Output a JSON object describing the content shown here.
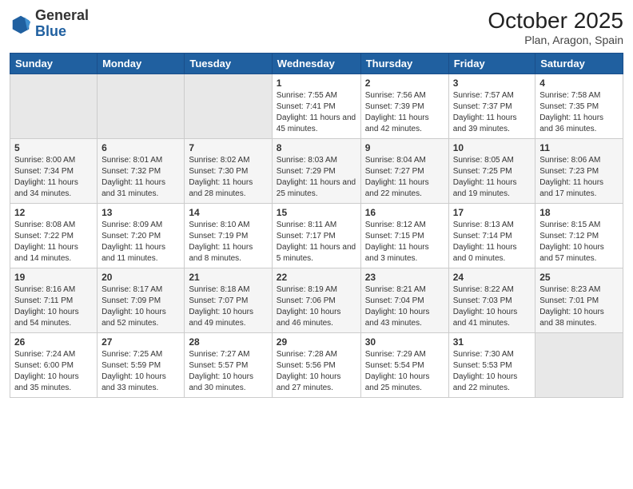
{
  "header": {
    "logo_general": "General",
    "logo_blue": "Blue",
    "title": "October 2025",
    "subtitle": "Plan, Aragon, Spain"
  },
  "weekdays": [
    "Sunday",
    "Monday",
    "Tuesday",
    "Wednesday",
    "Thursday",
    "Friday",
    "Saturday"
  ],
  "weeks": [
    [
      {
        "day": "",
        "info": ""
      },
      {
        "day": "",
        "info": ""
      },
      {
        "day": "",
        "info": ""
      },
      {
        "day": "1",
        "info": "Sunrise: 7:55 AM\nSunset: 7:41 PM\nDaylight: 11 hours and 45 minutes."
      },
      {
        "day": "2",
        "info": "Sunrise: 7:56 AM\nSunset: 7:39 PM\nDaylight: 11 hours and 42 minutes."
      },
      {
        "day": "3",
        "info": "Sunrise: 7:57 AM\nSunset: 7:37 PM\nDaylight: 11 hours and 39 minutes."
      },
      {
        "day": "4",
        "info": "Sunrise: 7:58 AM\nSunset: 7:35 PM\nDaylight: 11 hours and 36 minutes."
      }
    ],
    [
      {
        "day": "5",
        "info": "Sunrise: 8:00 AM\nSunset: 7:34 PM\nDaylight: 11 hours and 34 minutes."
      },
      {
        "day": "6",
        "info": "Sunrise: 8:01 AM\nSunset: 7:32 PM\nDaylight: 11 hours and 31 minutes."
      },
      {
        "day": "7",
        "info": "Sunrise: 8:02 AM\nSunset: 7:30 PM\nDaylight: 11 hours and 28 minutes."
      },
      {
        "day": "8",
        "info": "Sunrise: 8:03 AM\nSunset: 7:29 PM\nDaylight: 11 hours and 25 minutes."
      },
      {
        "day": "9",
        "info": "Sunrise: 8:04 AM\nSunset: 7:27 PM\nDaylight: 11 hours and 22 minutes."
      },
      {
        "day": "10",
        "info": "Sunrise: 8:05 AM\nSunset: 7:25 PM\nDaylight: 11 hours and 19 minutes."
      },
      {
        "day": "11",
        "info": "Sunrise: 8:06 AM\nSunset: 7:23 PM\nDaylight: 11 hours and 17 minutes."
      }
    ],
    [
      {
        "day": "12",
        "info": "Sunrise: 8:08 AM\nSunset: 7:22 PM\nDaylight: 11 hours and 14 minutes."
      },
      {
        "day": "13",
        "info": "Sunrise: 8:09 AM\nSunset: 7:20 PM\nDaylight: 11 hours and 11 minutes."
      },
      {
        "day": "14",
        "info": "Sunrise: 8:10 AM\nSunset: 7:19 PM\nDaylight: 11 hours and 8 minutes."
      },
      {
        "day": "15",
        "info": "Sunrise: 8:11 AM\nSunset: 7:17 PM\nDaylight: 11 hours and 5 minutes."
      },
      {
        "day": "16",
        "info": "Sunrise: 8:12 AM\nSunset: 7:15 PM\nDaylight: 11 hours and 3 minutes."
      },
      {
        "day": "17",
        "info": "Sunrise: 8:13 AM\nSunset: 7:14 PM\nDaylight: 11 hours and 0 minutes."
      },
      {
        "day": "18",
        "info": "Sunrise: 8:15 AM\nSunset: 7:12 PM\nDaylight: 10 hours and 57 minutes."
      }
    ],
    [
      {
        "day": "19",
        "info": "Sunrise: 8:16 AM\nSunset: 7:11 PM\nDaylight: 10 hours and 54 minutes."
      },
      {
        "day": "20",
        "info": "Sunrise: 8:17 AM\nSunset: 7:09 PM\nDaylight: 10 hours and 52 minutes."
      },
      {
        "day": "21",
        "info": "Sunrise: 8:18 AM\nSunset: 7:07 PM\nDaylight: 10 hours and 49 minutes."
      },
      {
        "day": "22",
        "info": "Sunrise: 8:19 AM\nSunset: 7:06 PM\nDaylight: 10 hours and 46 minutes."
      },
      {
        "day": "23",
        "info": "Sunrise: 8:21 AM\nSunset: 7:04 PM\nDaylight: 10 hours and 43 minutes."
      },
      {
        "day": "24",
        "info": "Sunrise: 8:22 AM\nSunset: 7:03 PM\nDaylight: 10 hours and 41 minutes."
      },
      {
        "day": "25",
        "info": "Sunrise: 8:23 AM\nSunset: 7:01 PM\nDaylight: 10 hours and 38 minutes."
      }
    ],
    [
      {
        "day": "26",
        "info": "Sunrise: 7:24 AM\nSunset: 6:00 PM\nDaylight: 10 hours and 35 minutes."
      },
      {
        "day": "27",
        "info": "Sunrise: 7:25 AM\nSunset: 5:59 PM\nDaylight: 10 hours and 33 minutes."
      },
      {
        "day": "28",
        "info": "Sunrise: 7:27 AM\nSunset: 5:57 PM\nDaylight: 10 hours and 30 minutes."
      },
      {
        "day": "29",
        "info": "Sunrise: 7:28 AM\nSunset: 5:56 PM\nDaylight: 10 hours and 27 minutes."
      },
      {
        "day": "30",
        "info": "Sunrise: 7:29 AM\nSunset: 5:54 PM\nDaylight: 10 hours and 25 minutes."
      },
      {
        "day": "31",
        "info": "Sunrise: 7:30 AM\nSunset: 5:53 PM\nDaylight: 10 hours and 22 minutes."
      },
      {
        "day": "",
        "info": ""
      }
    ]
  ]
}
